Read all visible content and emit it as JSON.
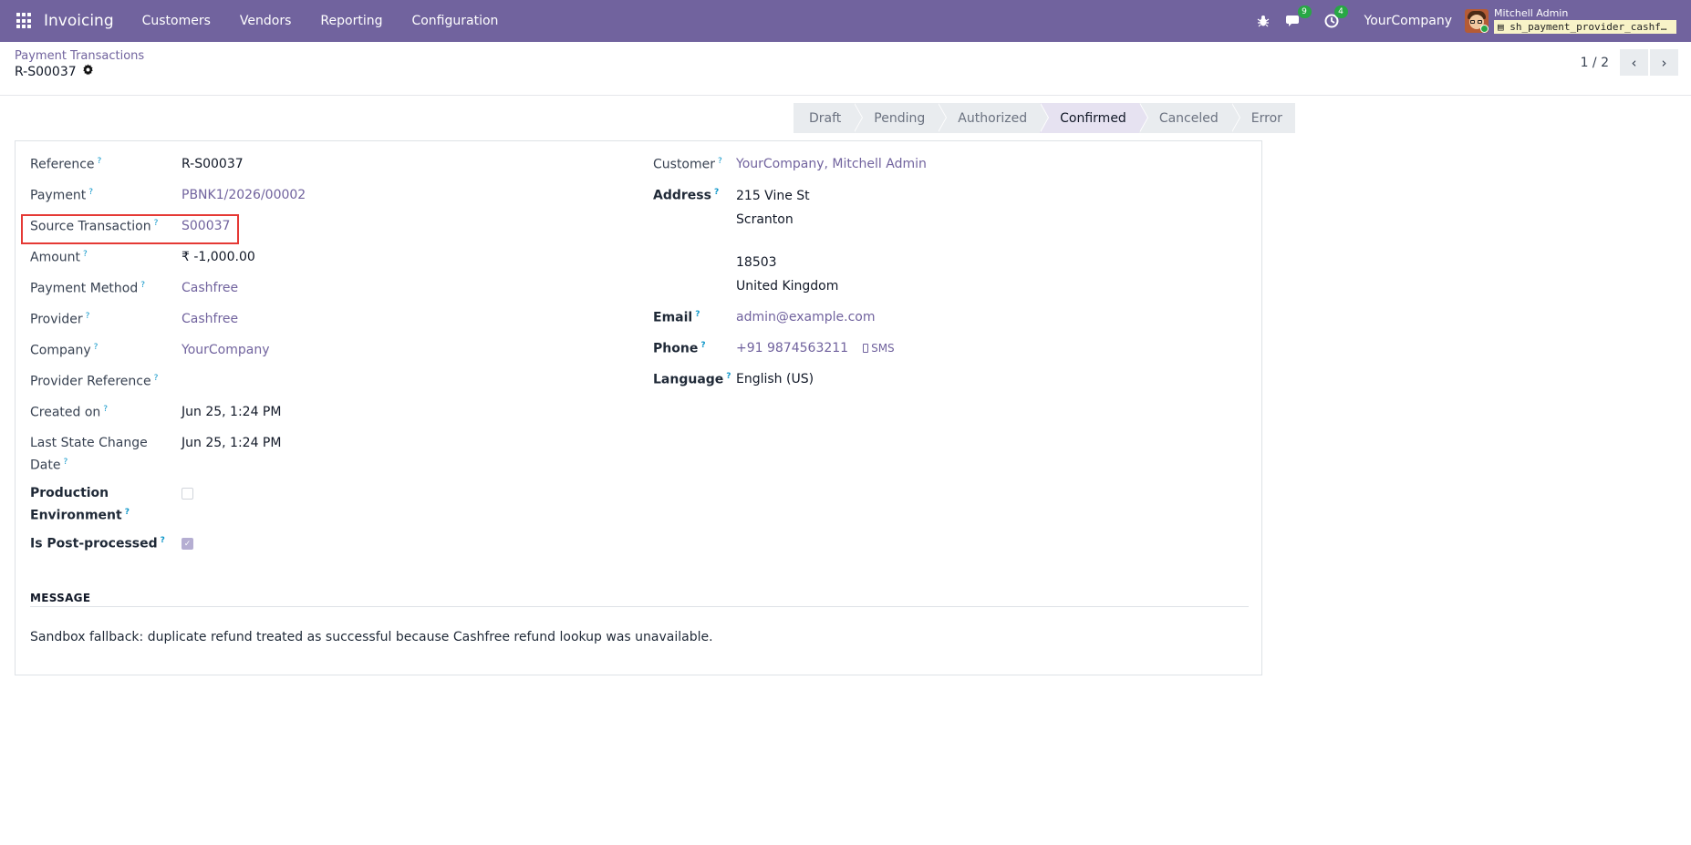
{
  "topbar": {
    "app_name": "Invoicing",
    "menu": [
      "Customers",
      "Vendors",
      "Reporting",
      "Configuration"
    ],
    "messages_count": "9",
    "activities_count": "4",
    "company": "YourCompany",
    "user_name": "Mitchell Admin",
    "database": "sh_payment_provider_cashfree"
  },
  "control": {
    "breadcrumb_parent": "Payment Transactions",
    "record_name": "R-S00037",
    "pager_value": "1 / 2"
  },
  "statusbar": {
    "stages": [
      "Draft",
      "Pending",
      "Authorized",
      "Confirmed",
      "Canceled",
      "Error"
    ],
    "active_stage": "Confirmed"
  },
  "form": {
    "left": {
      "reference_label": "Reference",
      "reference_value": "R-S00037",
      "payment_label": "Payment",
      "payment_value": "PBNK1/2026/00002",
      "source_label": "Source Transaction",
      "source_value": "S00037",
      "amount_label": "Amount",
      "amount_value": "₹ -1,000.00",
      "method_label": "Payment Method",
      "method_value": "Cashfree",
      "provider_label": "Provider",
      "provider_value": "Cashfree",
      "company_label": "Company",
      "company_value": "YourCompany",
      "provider_ref_label": "Provider Reference",
      "created_label": "Created on",
      "created_value": "Jun 25, 1:24 PM",
      "last_change_label_1": "Last State Change",
      "last_change_label_2": "Date",
      "last_change_value": "Jun 25, 1:24 PM",
      "production_label_1": "Production",
      "production_label_2": "Environment",
      "production_checked": false,
      "post_processed_label": "Is Post-processed",
      "post_processed_checked": true
    },
    "right": {
      "customer_label": "Customer",
      "customer_value": "YourCompany, Mitchell Admin",
      "address_label": "Address",
      "address_line1": "215 Vine St",
      "address_line2": "Scranton",
      "address_zip": "18503",
      "address_country": "United Kingdom",
      "email_label": "Email",
      "email_value": "admin@example.com",
      "phone_label": "Phone",
      "phone_value": "+91 9874563211",
      "sms_label": "SMS",
      "language_label": "Language",
      "language_value": "English (US)"
    },
    "message_title": "MESSAGE",
    "message_text": "Sandbox fallback: duplicate refund treated as successful because Cashfree refund lookup was unavailable."
  }
}
